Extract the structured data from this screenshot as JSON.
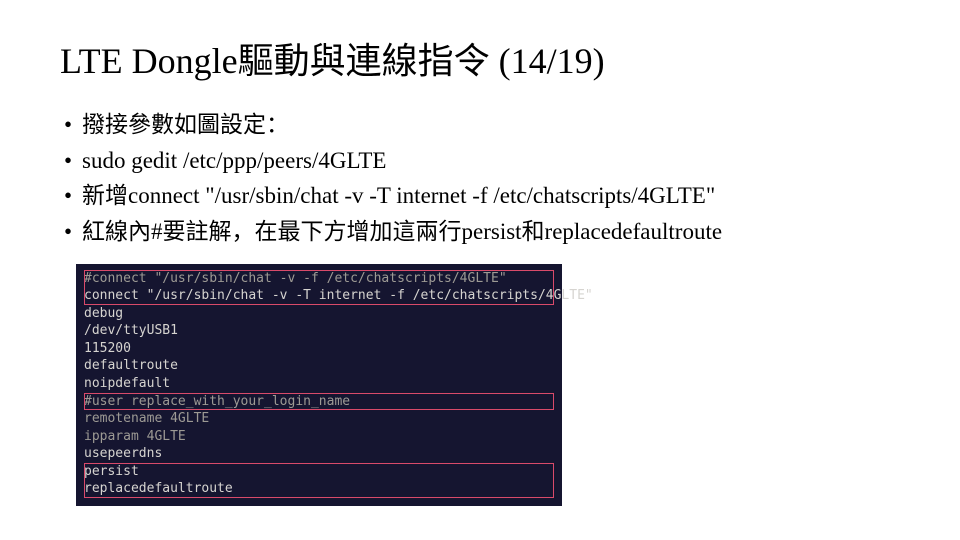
{
  "title": "LTE Dongle驅動與連線指令 (14/19)",
  "bullets": [
    "撥接參數如圖設定：",
    "sudo gedit /etc/ppp/peers/4GLTE",
    "新增connect \"/usr/sbin/chat -v -T internet -f /etc/chatscripts/4GLTE\"",
    "紅線內#要註解，在最下方增加這兩行persist和replacedefaultroute"
  ],
  "terminal": {
    "box1": [
      "#connect \"/usr/sbin/chat -v -f /etc/chatscripts/4GLTE\"",
      "connect \"/usr/sbin/chat -v -T internet -f /etc/chatscripts/4GLTE\""
    ],
    "mid": [
      "debug",
      "/dev/ttyUSB1",
      "115200",
      "defaultroute",
      "noipdefault"
    ],
    "box2": [
      "#user replace_with_your_login_name"
    ],
    "mid2": [
      "remotename 4GLTE",
      "ipparam 4GLTE",
      "",
      "usepeerdns"
    ],
    "box3": [
      "persist",
      "replacedefaultroute"
    ]
  }
}
